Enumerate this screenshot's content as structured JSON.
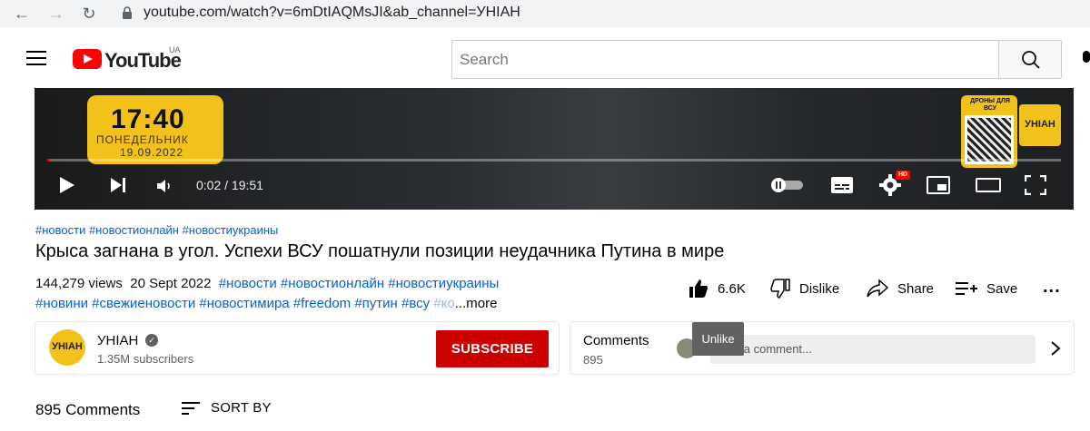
{
  "browser": {
    "url": "youtube.com/watch?v=6mDtIAQMsJI&ab_channel=УНІАН"
  },
  "header": {
    "logo_text": "YouTube",
    "country": "UA",
    "search_placeholder": "Search"
  },
  "player": {
    "overlay_time": "17:40",
    "overlay_day": "ПОНЕДЕЛЬНИК",
    "overlay_date": "19.09.2022",
    "qr_title": "ДРОНЫ ДЛЯ ВСУ",
    "channel_bug": "УНІАН",
    "time_display": "0:02 / 19:51",
    "progress": 0.0017,
    "hd_badge": "HD"
  },
  "video": {
    "hashtags_top": "#новости #новостионлайн #новостиукраины",
    "title": "Крыса загнана в угол. Успехи ВСУ пошатнули позиции неудачника Путина в мире",
    "views": "144,279 views",
    "date": "20 Sept 2022",
    "tags_line1": "#новости #новостионлайн #новостиукраины",
    "tags_line2": "#новини #свежиеновости #новостимира #freedom #путин #всу",
    "tags_line2_faded": "#ко",
    "more_label": "...more"
  },
  "actions": {
    "like_count": "6.6K",
    "dislike_label": "Dislike",
    "share_label": "Share",
    "save_label": "Save",
    "more_label": "..."
  },
  "channel": {
    "avatar_text": "УНІАН",
    "name": "УНІАН",
    "verified": "✓",
    "subscribers": "1.35M subscribers",
    "subscribe_label": "SUBSCRIBE"
  },
  "comments_panel": {
    "label": "Comments",
    "count": "895",
    "input_placeholder": "Add a comment...",
    "tooltip": "Unlike"
  },
  "comments_section": {
    "total": "895 Comments",
    "sort_label": "SORT BY"
  },
  "colors": {
    "accent_red": "#ff0000",
    "subscribe_red": "#cc0000",
    "link_blue": "#065fd4",
    "overlay_yellow": "#f2c21a"
  }
}
